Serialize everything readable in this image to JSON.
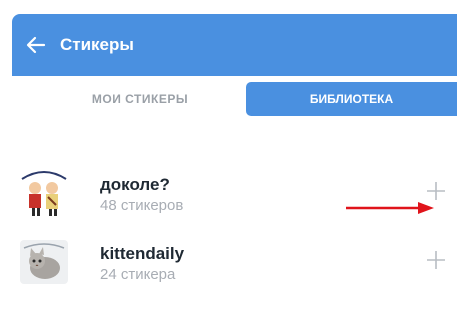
{
  "header": {
    "title": "Стикеры",
    "back_icon": "arrow-left-icon",
    "background_color": "#4a90e0"
  },
  "tabs": [
    {
      "label": "МОИ СТИКЕРЫ",
      "active": false
    },
    {
      "label": "БИБЛИОТЕКА",
      "active": true
    }
  ],
  "sticker_packs": [
    {
      "name": "доколе?",
      "count": "48 стикеров",
      "thumbnail": "cartoon-sticker-pack",
      "action_icon": "plus-icon"
    },
    {
      "name": "kittendaily",
      "count": "24 стикера",
      "thumbnail": "kitten-sticker-pack",
      "action_icon": "plus-icon"
    }
  ],
  "annotation": {
    "arrow_color": "#e0141b"
  }
}
